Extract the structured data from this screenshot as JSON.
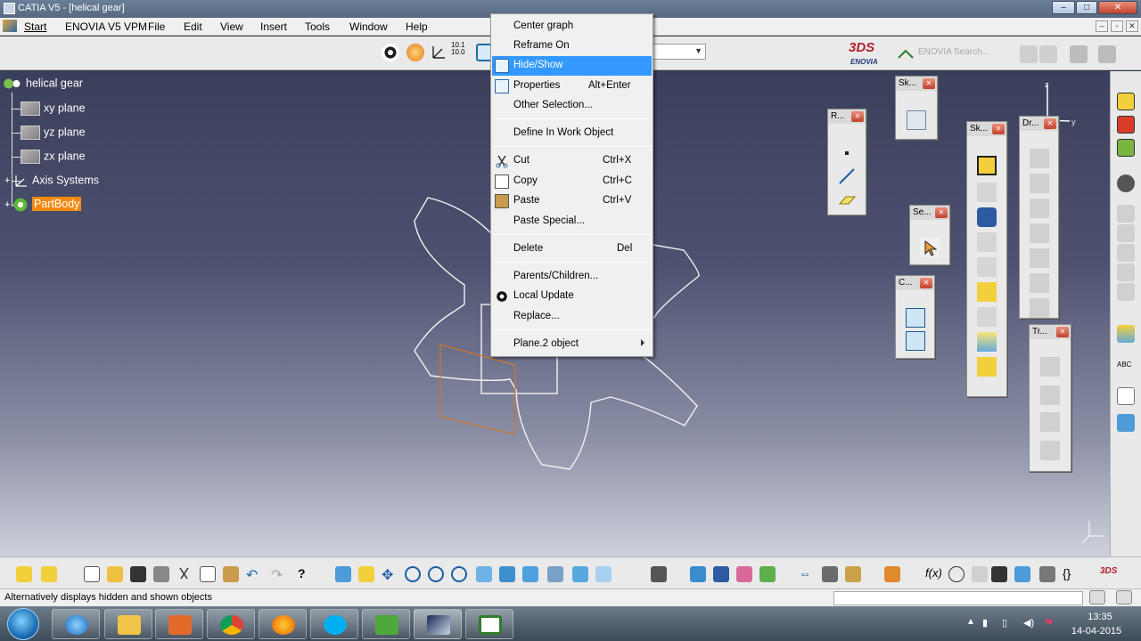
{
  "window": {
    "title": "CATIA V5 - [helical gear]",
    "min": "–",
    "max": "□",
    "close": "✕"
  },
  "menubar": {
    "items": [
      "Start",
      "ENOVIA V5 VPM",
      "File",
      "Edit",
      "View",
      "Insert",
      "Tools",
      "Window",
      "Help"
    ]
  },
  "top_toolbar": {
    "coord_label": "10.1\n10.0",
    "enovia_logo": {
      "ds": "3DS",
      "text": "ENOVIA"
    },
    "enovia_search": "ENOVIA Search..."
  },
  "spec_tree": {
    "root": "helical gear",
    "children": [
      "xy plane",
      "yz plane",
      "zx plane",
      "Axis Systems",
      "PartBody"
    ]
  },
  "context_menu": {
    "items": [
      {
        "label": "Center graph",
        "shortcut": "",
        "icon": ""
      },
      {
        "label": "Reframe On",
        "shortcut": "",
        "icon": ""
      },
      {
        "label": "Hide/Show",
        "shortcut": "",
        "icon": "hide-show-icon",
        "highlighted": true
      },
      {
        "label": "Properties",
        "shortcut": "Alt+Enter",
        "icon": "properties-icon"
      },
      {
        "label": "Other Selection...",
        "shortcut": "",
        "icon": ""
      },
      {
        "label": "Define In Work Object",
        "shortcut": "",
        "icon": ""
      },
      {
        "label": "Cut",
        "shortcut": "Ctrl+X",
        "icon": "scissors-icon"
      },
      {
        "label": "Copy",
        "shortcut": "Ctrl+C",
        "icon": "copy-icon"
      },
      {
        "label": "Paste",
        "shortcut": "Ctrl+V",
        "icon": "paste-icon"
      },
      {
        "label": "Paste Special...",
        "shortcut": "",
        "icon": ""
      },
      {
        "label": "Delete",
        "shortcut": "Del",
        "icon": ""
      },
      {
        "label": "Parents/Children...",
        "shortcut": "",
        "icon": ""
      },
      {
        "label": "Local Update",
        "shortcut": "",
        "icon": "local-update-icon"
      },
      {
        "label": "Replace...",
        "shortcut": "",
        "icon": ""
      },
      {
        "label": "Plane.2 object",
        "shortcut": "",
        "icon": "",
        "submenu": true
      }
    ]
  },
  "floating_toolbars": [
    {
      "title": "R..."
    },
    {
      "title": "Sk..."
    },
    {
      "title": "Sk..."
    },
    {
      "title": "Dr..."
    },
    {
      "title": "Se..."
    },
    {
      "title": "C..."
    },
    {
      "title": "Tr..."
    }
  ],
  "status": {
    "message": "Alternatively displays hidden and shown objects"
  },
  "taskbar": {
    "time": "13:35",
    "date": "14-04-2015"
  },
  "colors": {
    "highlight": "#3399ff",
    "partbody": "#f28a12",
    "gear_outline": "#f2f2f2",
    "plane_orange": "#d0762d"
  }
}
